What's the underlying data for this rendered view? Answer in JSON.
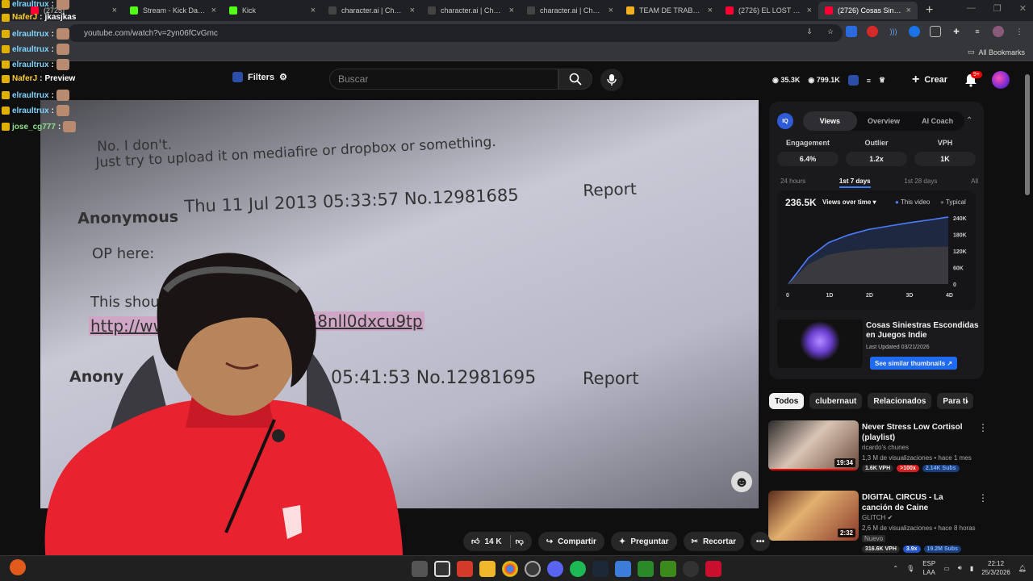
{
  "browser": {
    "tabs": [
      {
        "title": "(2725)",
        "color": "#ff0033",
        "active": false
      },
      {
        "title": "Stream - Kick Dashbo",
        "color": "#53fc18",
        "active": false
      },
      {
        "title": "Kick",
        "color": "#53fc18",
        "active": false
      },
      {
        "title": "character.ai | Chat de",
        "color": "#444",
        "active": false
      },
      {
        "title": "character.ai | Chat de",
        "color": "#444",
        "active": false
      },
      {
        "title": "character.ai | Chat de",
        "color": "#444",
        "active": false
      },
      {
        "title": "TEAM DE TRABAJO L",
        "color": "#f2b01e",
        "active": false
      },
      {
        "title": "(2726) EL LOST MEDI",
        "color": "#ff0033",
        "active": false
      },
      {
        "title": "(2726) Cosas Siniestr",
        "color": "#ff0033",
        "active": true
      }
    ],
    "new_tab": "+",
    "url": "youtube.com/watch?v=2yn06fCvGmc",
    "bookmarks_label": "All Bookmarks"
  },
  "youtube": {
    "filters_label": "Filters",
    "search_placeholder": "Buscar",
    "header_stats": [
      "35.3K",
      "799.1K"
    ],
    "create_label": "Crear",
    "notif_count": "9+"
  },
  "video": {
    "lines": [
      {
        "text": "No. I don't.",
        "cls": "v-mute"
      },
      {
        "text": "Just try to upload it on mediafire or dropbox or something.",
        "cls": "v-mute"
      },
      {
        "text": "Anonymous",
        "cls": "v-anon"
      },
      {
        "text": "Thu 11 Jul 2013 05:33:57 No.12981685",
        "cls": "v-head"
      },
      {
        "text": "Report",
        "cls": "v-report"
      },
      {
        "text": "OP here:",
        "cls": "v-body"
      },
      {
        "text": "This should w",
        "cls": "v-body"
      },
      {
        "text": "http://www.",
        "cls": "v-link"
      },
      {
        "text": "z58nll0dxcu9tp",
        "cls": "v-link"
      },
      {
        "text": "Anony",
        "cls": "v-anon"
      },
      {
        "text": "05:41:53 No.12981695",
        "cls": "v-head"
      },
      {
        "text": "Report",
        "cls": "v-report"
      }
    ]
  },
  "chat": [
    {
      "user": "elraultrux",
      "color": "#7fd4ff",
      "msg": ""
    },
    {
      "user": "NaferJ",
      "color": "#ffcc33",
      "msg": "jkasjkas"
    },
    {
      "user": "elraultrux",
      "color": "#7fd4ff",
      "msg": ""
    },
    {
      "user": "elraultrux",
      "color": "#7fd4ff",
      "msg": ""
    },
    {
      "user": "elraultrux",
      "color": "#7fd4ff",
      "msg": ""
    },
    {
      "user": "NaferJ",
      "color": "#ffcc33",
      "msg": "Preview"
    },
    {
      "user": "elraultrux",
      "color": "#7fd4ff",
      "msg": ""
    },
    {
      "user": "elraultrux",
      "color": "#7fd4ff",
      "msg": ""
    },
    {
      "user": "jose_cg777",
      "color": "#8fe08f",
      "msg": ""
    }
  ],
  "panel": {
    "logo": "IQ",
    "tabs": [
      "Views",
      "Overview",
      "AI Coach"
    ],
    "metrics": [
      {
        "label": "Engagement",
        "value": "6.4%"
      },
      {
        "label": "Outlier",
        "value": "1.2x"
      },
      {
        "label": "VPH",
        "value": "1K"
      }
    ],
    "periods": [
      "24 hours",
      "1st 7 days",
      "1st 28 days",
      "All"
    ],
    "views_total": "236.5K",
    "views_dropdown": "Views over time",
    "legend_this": "This video",
    "legend_typical": "Typical",
    "video_title": "Cosas Siniestras Escondidas en Juegos Indie",
    "last_updated": "Last Updated 03/21/2026",
    "similar_label": "See similar thumbnails"
  },
  "chart_data": {
    "type": "area",
    "x": [
      0,
      5,
      10,
      15,
      20,
      25,
      30,
      35,
      40
    ],
    "xticks": [
      "0",
      "1D",
      "2D",
      "3D",
      "4D"
    ],
    "yticks": [
      "240K",
      "180K",
      "120K",
      "60K",
      "0"
    ],
    "ylim": [
      0,
      240000
    ],
    "series": [
      {
        "name": "This video",
        "values": [
          0,
          95000,
          150000,
          178000,
          198000,
          210000,
          222000,
          232000,
          243000
        ],
        "color": "#4a7dff"
      },
      {
        "name": "Typical",
        "values": [
          0,
          70000,
          105000,
          118000,
          125000,
          129000,
          131000,
          133000,
          134000
        ],
        "color": "#3a3a3e"
      }
    ]
  },
  "chips": [
    "Todos",
    "clubernaut",
    "Relacionados",
    "Para ti"
  ],
  "recs": [
    {
      "title": "Never Stress Low Cortisol (playlist)",
      "channel": "ricardo's chunes",
      "meta": "1,3 M de visualizaciones • hace 1 mes",
      "duration": "19:34",
      "tags": [
        {
          "t": "1.6K VPH",
          "c": ""
        },
        {
          "t": ">100x",
          "c": "red"
        },
        {
          "t": "2.14K Subs",
          "c": "blue"
        }
      ]
    },
    {
      "title": "DIGITAL CIRCUS - La canción de Caine",
      "channel": "GLITCH",
      "meta": "2,6 M de visualizaciones • hace 8 horas",
      "badge": "Nuevo",
      "duration": "2:32",
      "tags": [
        {
          "t": "316.6K VPH",
          "c": ""
        },
        {
          "t": "3.9x",
          "c": "bluebright"
        },
        {
          "t": "19.2M Subs",
          "c": "blue"
        }
      ]
    }
  ],
  "actions": {
    "likes": "14 K",
    "share": "Compartir",
    "ask": "Preguntar",
    "clip": "Recortar"
  },
  "taskbar": {
    "lang": "ESP",
    "lang2": "LAA",
    "time": "22:12",
    "date": "25/3/2026"
  }
}
